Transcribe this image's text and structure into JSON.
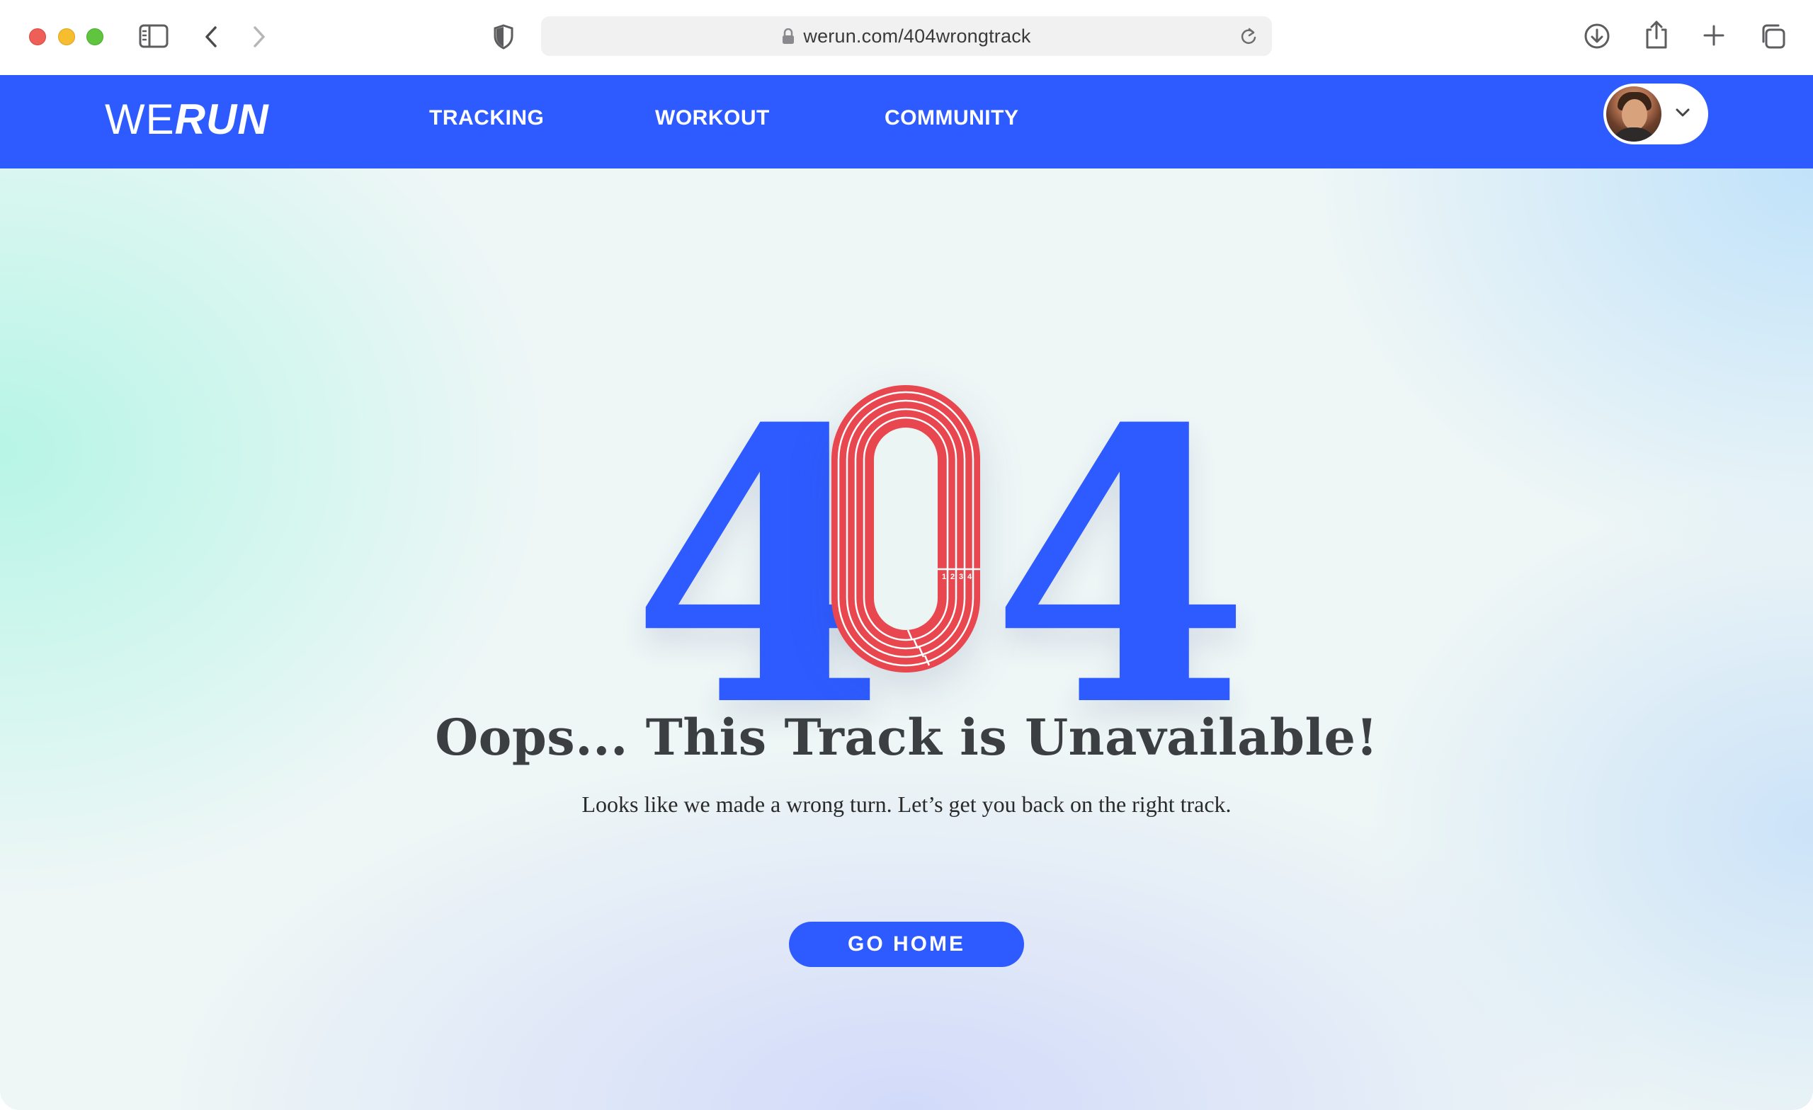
{
  "browser": {
    "url": "werun.com/404wrongtrack",
    "icons": [
      "sidebar-icon",
      "back-icon",
      "forward-icon",
      "shield-icon",
      "lock-icon",
      "reload-icon",
      "download-icon",
      "share-icon",
      "new-tab-icon",
      "tabs-overview-icon"
    ]
  },
  "nav": {
    "logo_we": "WE",
    "logo_run": "RUN",
    "items": [
      "TRACKING",
      "WORKOUT",
      "COMMUNITY"
    ],
    "user_menu_icon": "chevron-down-icon"
  },
  "error": {
    "digit_left": "4",
    "digit_right": "4",
    "track_lanes": [
      "1",
      "2",
      "3",
      "4"
    ],
    "headline": "Oops... This Track is Unavailable!",
    "message": "Looks like we made a wrong turn. Let’s get you back on the right track.",
    "cta": "GO HOME"
  },
  "colors": {
    "brand": "#2d5bff",
    "track": "#e8474f",
    "headline": "#3c3f42"
  }
}
